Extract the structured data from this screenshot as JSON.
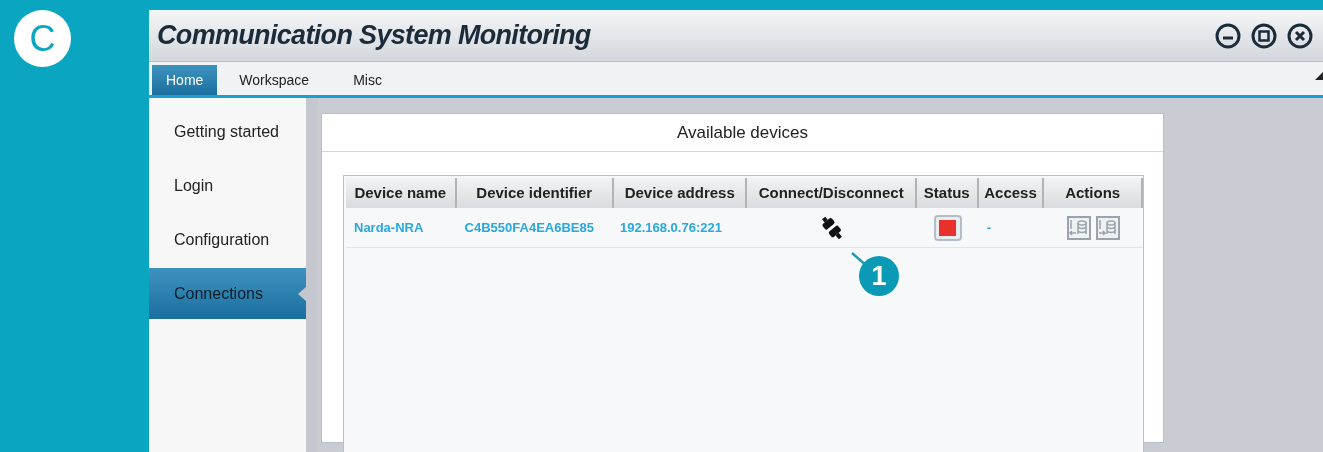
{
  "badge": "C",
  "window": {
    "title": "Communication System Monitoring"
  },
  "tabs": [
    {
      "label": "Home",
      "selected": true
    },
    {
      "label": "Workspace",
      "selected": false
    },
    {
      "label": "Misc",
      "selected": false
    }
  ],
  "sidebar": {
    "items": [
      {
        "label": "Getting started",
        "selected": false
      },
      {
        "label": "Login",
        "selected": false
      },
      {
        "label": "Configuration",
        "selected": false
      },
      {
        "label": "Connections",
        "selected": true
      }
    ]
  },
  "panel": {
    "title": "Available devices"
  },
  "table": {
    "columns": [
      "Device name",
      "Device identifier",
      "Device address",
      "Connect/Disconnect",
      "Status",
      "Access",
      "Actions"
    ],
    "rows": [
      {
        "name": "Narda-NRA",
        "identifier": "C4B550FA4EA6BE85",
        "address": "192.168.0.76:221",
        "color": "#e8302c",
        "access": "-"
      }
    ]
  },
  "callout": "1"
}
